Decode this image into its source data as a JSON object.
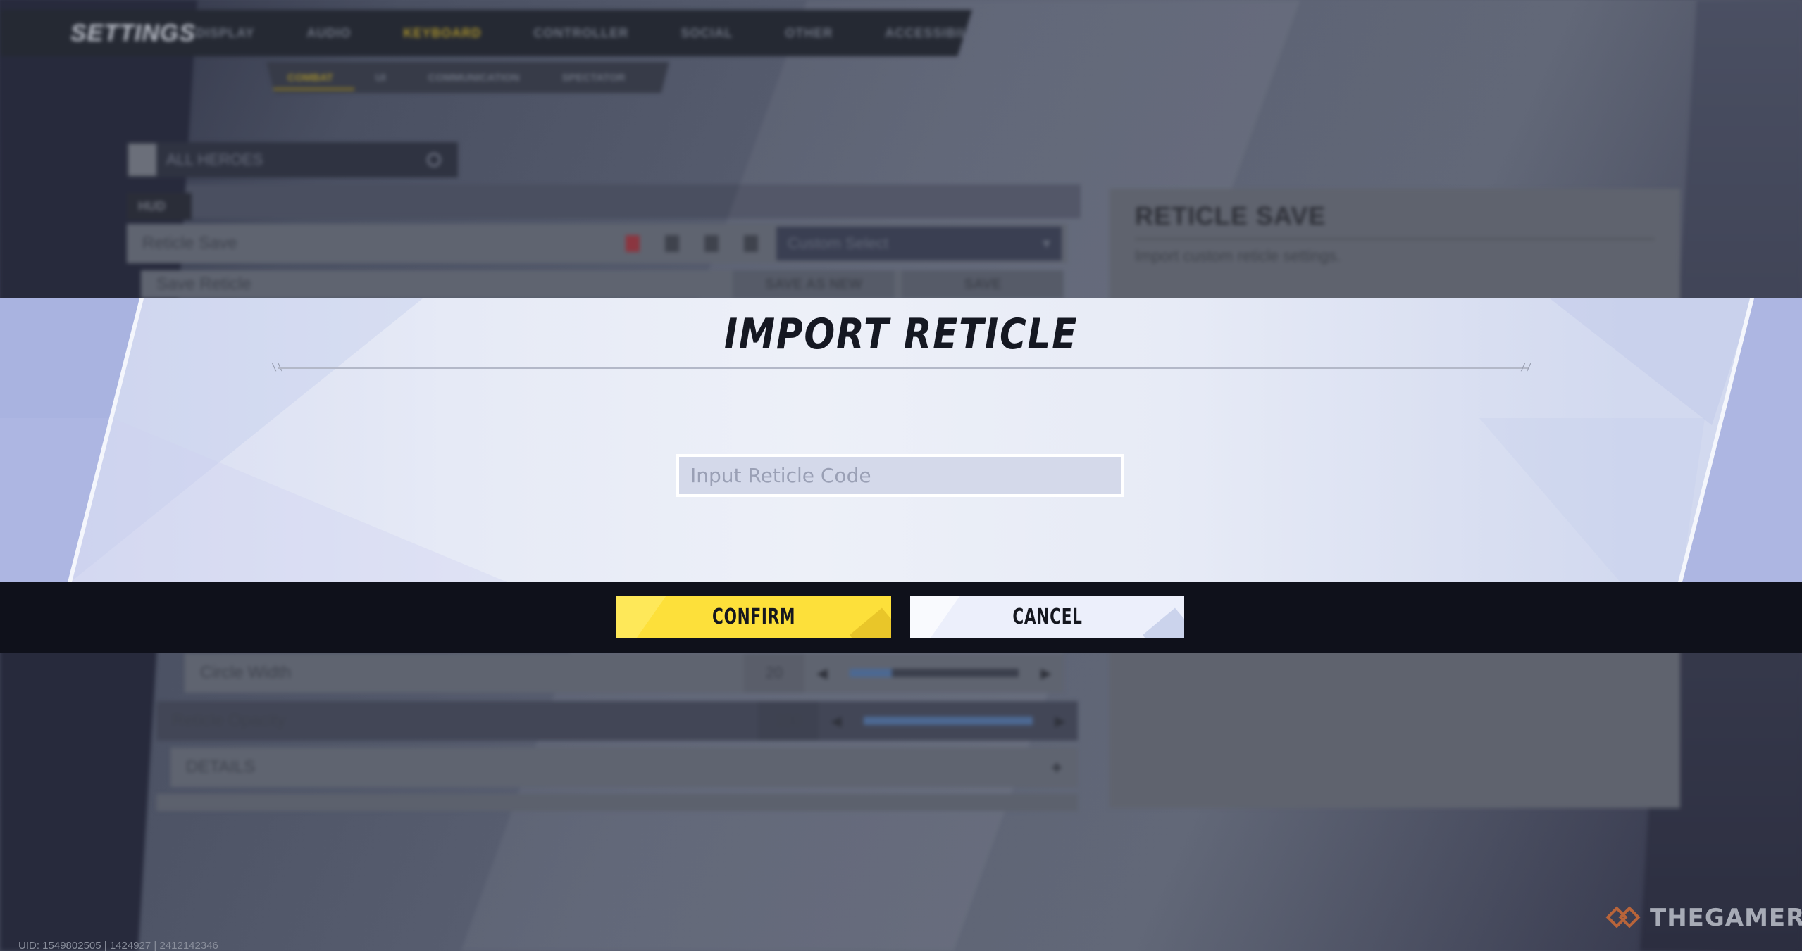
{
  "settings": {
    "title": "SETTINGS",
    "tabs": [
      {
        "label": "DISPLAY",
        "active": false
      },
      {
        "label": "AUDIO",
        "active": false
      },
      {
        "label": "KEYBOARD",
        "active": true
      },
      {
        "label": "CONTROLLER",
        "active": false
      },
      {
        "label": "SOCIAL",
        "active": false
      },
      {
        "label": "OTHER",
        "active": false
      },
      {
        "label": "ACCESSIBILITY",
        "active": false
      }
    ],
    "subtabs": [
      {
        "label": "COMBAT",
        "active": true
      },
      {
        "label": "UI",
        "active": false
      },
      {
        "label": "COMMUNICATION",
        "active": false
      },
      {
        "label": "SPECTATOR",
        "active": false
      }
    ],
    "hero_filter": {
      "label": "ALL HEROES",
      "icon": "search-icon"
    },
    "section_tag": "HUD",
    "reticle_save_row": {
      "label": "Reticle Save",
      "icons": [
        "trash-icon",
        "edit-icon",
        "import-icon",
        "copy-icon"
      ],
      "preset_value": "Custom Select"
    },
    "save_reticle_row": {
      "label": "Save Reticle",
      "save_as_new": "SAVE AS NEW",
      "save": "SAVE"
    },
    "rows": [
      {
        "label": "Circle Width",
        "value": "20",
        "slider_fraction": 0.25
      },
      {
        "label": "Reticle Opacity",
        "value": "100",
        "slider_fraction": 1.0
      },
      {
        "label": "DETAILS",
        "value": "",
        "expand": "+"
      }
    ],
    "right_panel": {
      "title": "RETICLE SAVE",
      "description": "Import custom reticle settings."
    }
  },
  "modal": {
    "title": "IMPORT RETICLE",
    "input": {
      "placeholder": "Input Reticle Code",
      "value": ""
    },
    "confirm_label": "CONFIRM",
    "cancel_label": "CANCEL",
    "colors": {
      "confirm": "#fde03a",
      "cancel": "#eceffb",
      "footer": "#0f111b",
      "band": "#adb6e2"
    }
  },
  "footer": {
    "uid": "UID: 1549802505 | 1424927 | 2412142346",
    "watermark": "THEGAMER"
  }
}
